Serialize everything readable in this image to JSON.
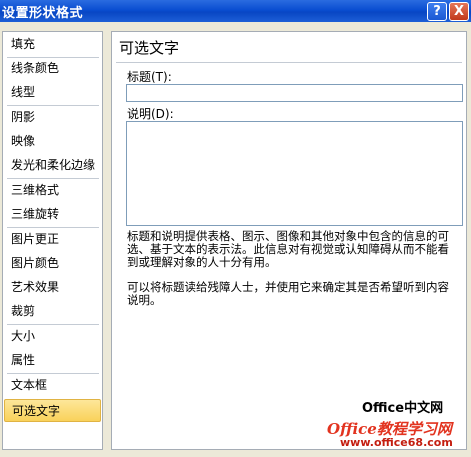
{
  "window": {
    "title": "设置形状格式",
    "help_label": "?",
    "close_label": "X"
  },
  "sidebar": {
    "items": [
      {
        "label": "填充"
      },
      {
        "label": "线条颜色"
      },
      {
        "label": "线型"
      },
      {
        "label": "阴影"
      },
      {
        "label": "映像"
      },
      {
        "label": "发光和柔化边缘"
      },
      {
        "label": "三维格式"
      },
      {
        "label": "三维旋转"
      },
      {
        "label": "图片更正"
      },
      {
        "label": "图片颜色"
      },
      {
        "label": "艺术效果"
      },
      {
        "label": "裁剪"
      },
      {
        "label": "大小"
      },
      {
        "label": "属性"
      },
      {
        "label": "文本框"
      },
      {
        "label": "可选文字"
      }
    ],
    "selected": "可选文字"
  },
  "panel": {
    "heading": "可选文字",
    "title_label": "标题(T):",
    "title_value": "",
    "description_label": "说明(D):",
    "description_value": "",
    "help_text_1": "标题和说明提供表格、图示、图像和其他对象中包含的信息的可选、基于文本的表示法。此信息对有视觉或认知障碍从而不能看到或理解对象的人十分有用。",
    "help_text_2": "可以将标题读给残障人士，并使用它来确定其是否希望听到内容说明。"
  },
  "watermark": {
    "line1": "Office中文网",
    "line2": "Office教程学习网",
    "line3": "www.office68.com"
  }
}
